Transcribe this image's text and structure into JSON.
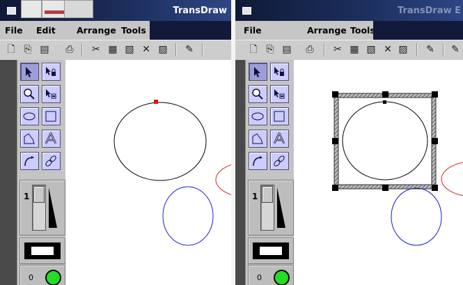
{
  "windows": [
    {
      "id": "left",
      "title": "TransDraw",
      "menu": [
        "File",
        "Edit",
        "Arrange",
        "Tools"
      ],
      "selection_state": "point-selected",
      "line_width": "1",
      "object_count": "0",
      "status_color": "#22dd22"
    },
    {
      "id": "right",
      "title": "TransDraw E",
      "menu": [
        "File",
        "Arrange",
        "Tools"
      ],
      "selection_state": "object-selected",
      "line_width": "1",
      "object_count": "0",
      "status_color": "#22dd22"
    }
  ],
  "toolbar_icons": [
    "new-icon",
    "open-icon",
    "save-icon",
    "print-icon",
    "cut-icon",
    "copy-icon",
    "paste-icon",
    "delete-icon",
    "duplicate-icon",
    "link-icon"
  ],
  "tools": [
    "select-arrow-tool",
    "lock-select-tool",
    "zoom-tool",
    "point-select-tool",
    "ellipse-tool",
    "rectangle-tool",
    "polygon-tool",
    "text-tool",
    "curve-tool",
    "link-tool"
  ],
  "colors": {
    "title_gradient_start": "#0f1a36",
    "title_gradient_end": "#2d4684",
    "tool_bg": "#ccccff",
    "tool_selected_bg": "#9d9dd8",
    "ellipse_black": "#000000",
    "ellipse_blue": "#1a1ad8",
    "ellipse_red": "#e02020",
    "handle": "#000000",
    "selected_point": "#e01010"
  }
}
